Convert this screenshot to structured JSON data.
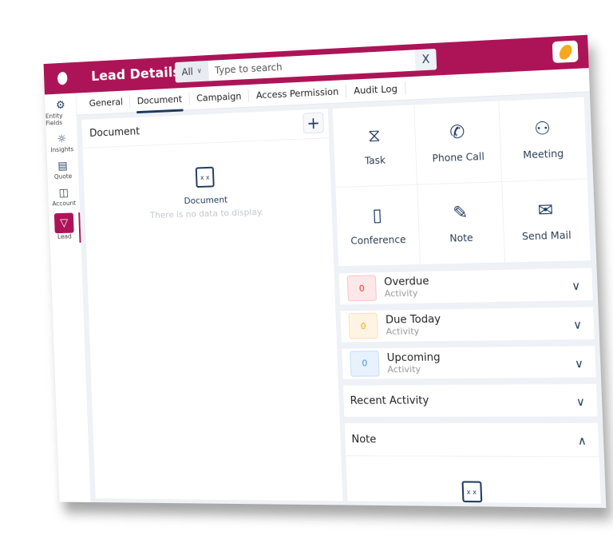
{
  "header": {
    "title": "Lead Details",
    "search_scope": "All",
    "search_placeholder": "Type to search",
    "clear_label": "X"
  },
  "sidebar": {
    "items": [
      {
        "label": "Entity Fields",
        "icon": "gear-box-icon",
        "glyph": "⚙"
      },
      {
        "label": "Insights",
        "icon": "lightbulb-icon",
        "glyph": "☼"
      },
      {
        "label": "Quote",
        "icon": "quote-doc-icon",
        "glyph": "▤"
      },
      {
        "label": "Account",
        "icon": "account-book-icon",
        "glyph": "◫"
      },
      {
        "label": "Lead",
        "icon": "funnel-icon",
        "glyph": "▽"
      }
    ]
  },
  "tabs": [
    "General",
    "Document",
    "Campaign",
    "Access Permission",
    "Audit Log"
  ],
  "document_panel": {
    "title": "Document",
    "add_label": "+",
    "empty_title": "Document",
    "empty_subtitle": "There is no data to display."
  },
  "actions": [
    {
      "label": "Task",
      "glyph": "⧖"
    },
    {
      "label": "Phone Call",
      "glyph": "✆"
    },
    {
      "label": "Meeting",
      "glyph": "⚇"
    },
    {
      "label": "Conference",
      "glyph": "▯"
    },
    {
      "label": "Note",
      "glyph": "✎"
    },
    {
      "label": "Send Mail",
      "glyph": "✉"
    }
  ],
  "activities": [
    {
      "title": "Overdue",
      "subtitle": "Activity",
      "count": "0",
      "color": "#e53935",
      "bg": "#fde7e9",
      "border": "#f8c4c8"
    },
    {
      "title": "Due Today",
      "subtitle": "Activity",
      "count": "0",
      "color": "#f5a623",
      "bg": "#fff4e3",
      "border": "#fde0b3"
    },
    {
      "title": "Upcoming",
      "subtitle": "Activity",
      "count": "0",
      "color": "#4a90e2",
      "bg": "#e8f2fe",
      "border": "#c5dcf8"
    }
  ],
  "recent_activity": {
    "title": "Recent Activity"
  },
  "note_panel": {
    "title": "Note"
  },
  "chevron_down": "∨",
  "chevron_up": "∧"
}
